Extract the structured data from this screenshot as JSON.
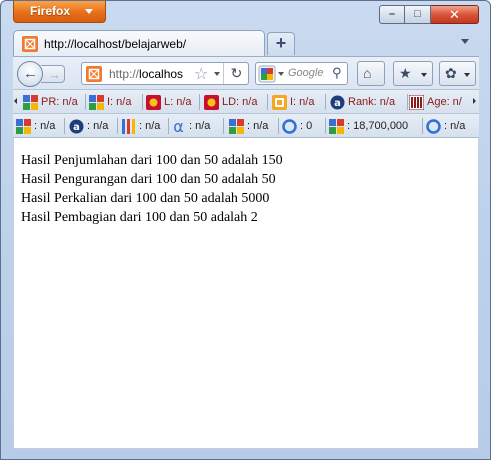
{
  "window": {
    "app_button_label": "Firefox",
    "minimize_glyph": "–",
    "maximize_glyph": "□",
    "close_glyph": "✕"
  },
  "tabs": [
    {
      "title": "http://localhost/belajarweb/",
      "icon": "localhost-page-icon"
    }
  ],
  "new_tab_glyph": "+",
  "nav": {
    "url_prefix": "http://",
    "url_host": "localhos",
    "search_placeholder": "Google",
    "reload_glyph": "↻",
    "back_glyph": "←",
    "forward_glyph": "→",
    "star_glyph": "☆",
    "search_glyph": "⚲",
    "home_glyph": "⌂",
    "bookmarks_glyph": "★",
    "addon_glyph": "✿"
  },
  "seo_bar_1": [
    {
      "icon": "google-pagerank-icon",
      "text": "PR: n/a"
    },
    {
      "icon": "google-index-icon",
      "text": "I: n/a"
    },
    {
      "icon": "yahoo-links-icon",
      "text": "L: n/a"
    },
    {
      "icon": "yahoo-linkdomain-icon",
      "text": "LD: n/a"
    },
    {
      "icon": "bing-index-icon",
      "text": "I: n/a"
    },
    {
      "icon": "alexa-rank-icon",
      "text": "Rank: n/a"
    },
    {
      "icon": "archive-age-icon",
      "text": "Age: n/"
    }
  ],
  "seo_bar_2": [
    {
      "icon": "google-cache-icon",
      "text": ": n/a"
    },
    {
      "icon": "alexa-icon",
      "text": ": n/a"
    },
    {
      "icon": "delicious-icon",
      "text": ": n/a"
    },
    {
      "icon": "alpha-icon",
      "text": ": n/a"
    },
    {
      "icon": "google-icon",
      "text": ": n/a"
    },
    {
      "icon": "bing-icon",
      "text": ": 0"
    },
    {
      "icon": "google-results-icon",
      "text": ": 18,700,000"
    },
    {
      "icon": "bing-results-icon",
      "text": ": n/a"
    }
  ],
  "content": {
    "lines": [
      "Hasil Penjumlahan dari 100 dan 50 adalah 150",
      "Hasil Pengurangan dari 100 dan 50 adalah 50",
      "Hasil Perkalian dari 100 dan 50 adalah 5000",
      "Hasil Pembagian dari 100 dan 50 adalah 2"
    ]
  },
  "colors": {
    "firefox_orange": "#e8701a",
    "chrome_blue": "#c9daf0",
    "seo_text_red": "#8b1a1a"
  }
}
